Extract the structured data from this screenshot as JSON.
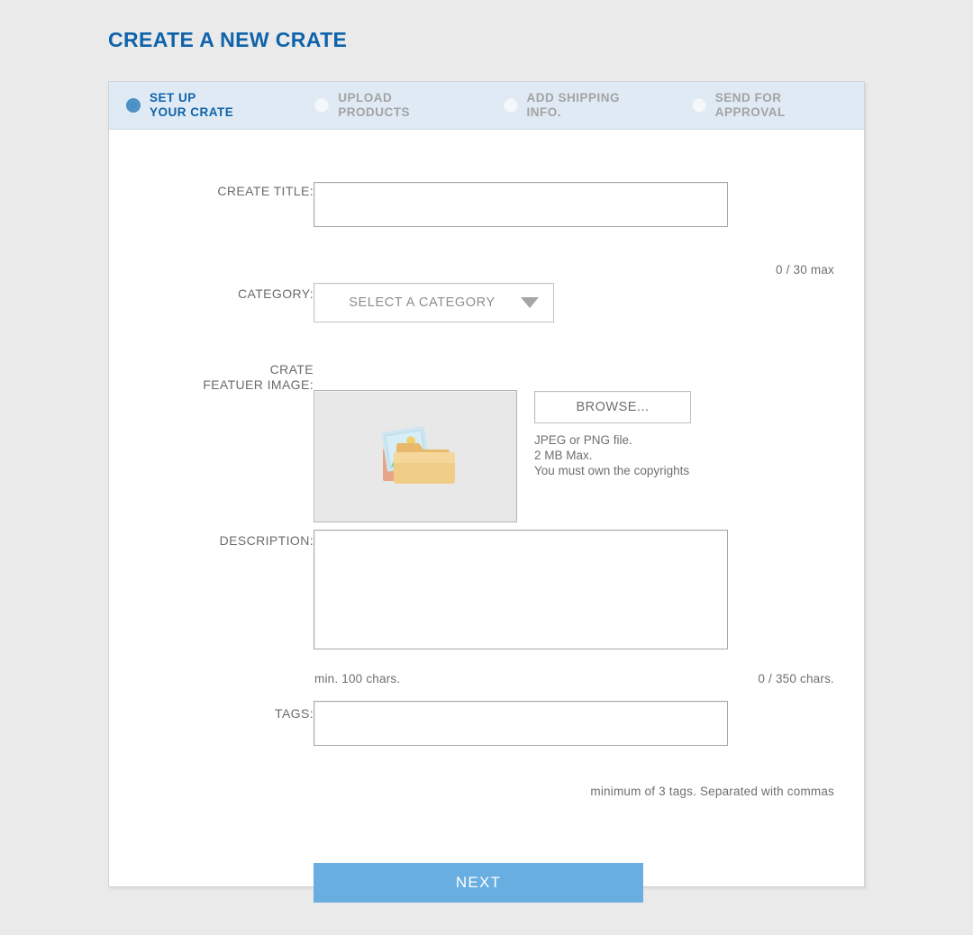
{
  "page": {
    "title": "CREATE A NEW CRATE",
    "accent_blue": "#0e63ab",
    "background": "#eaeaea",
    "card_background": "#ffffff"
  },
  "steps": {
    "bar_background": "#dfeaf4",
    "active_color": "#0e63ab",
    "inactive_color": "#a3a3a3",
    "items": [
      {
        "label": "SET UP\nYOUR CRATE",
        "state": "active",
        "icon": "radio-selected-icon"
      },
      {
        "label": "UPLOAD\nPRODUCTS",
        "state": "inactive",
        "icon": "radio-empty-icon"
      },
      {
        "label": "ADD SHIPPING\nINFO.",
        "state": "inactive",
        "icon": "radio-empty-icon"
      },
      {
        "label": "SEND FOR\nAPPROVAL",
        "state": "inactive",
        "icon": "radio-empty-icon"
      }
    ]
  },
  "form": {
    "title_field": {
      "label": "CREATE TITLE:",
      "value": "",
      "placeholder": "",
      "counter": "0 / 30 max"
    },
    "category_field": {
      "label": "CATEGORY:",
      "selected": "SELECT A CATEGORY",
      "arrow_icon": "chevron-down-icon"
    },
    "feature_image": {
      "label": "CRATE\nFEATUER IMAGE:",
      "preview_icon": "folder-with-photos-icon",
      "browse_label": "BROWSE...",
      "notes": "JPEG or PNG file.\n2 MB Max.\nYou must own the copyrights"
    },
    "description_field": {
      "label": "DESCRIPTION:",
      "value": "",
      "placeholder": "",
      "min_hint": "min. 100 chars.",
      "counter": "0 / 350 chars."
    },
    "tags_field": {
      "label": "TAGS:",
      "value": "",
      "placeholder": "",
      "hint": "minimum of 3 tags. Separated with commas"
    },
    "submit": {
      "label": "NEXT",
      "color": "#68aee0"
    }
  }
}
